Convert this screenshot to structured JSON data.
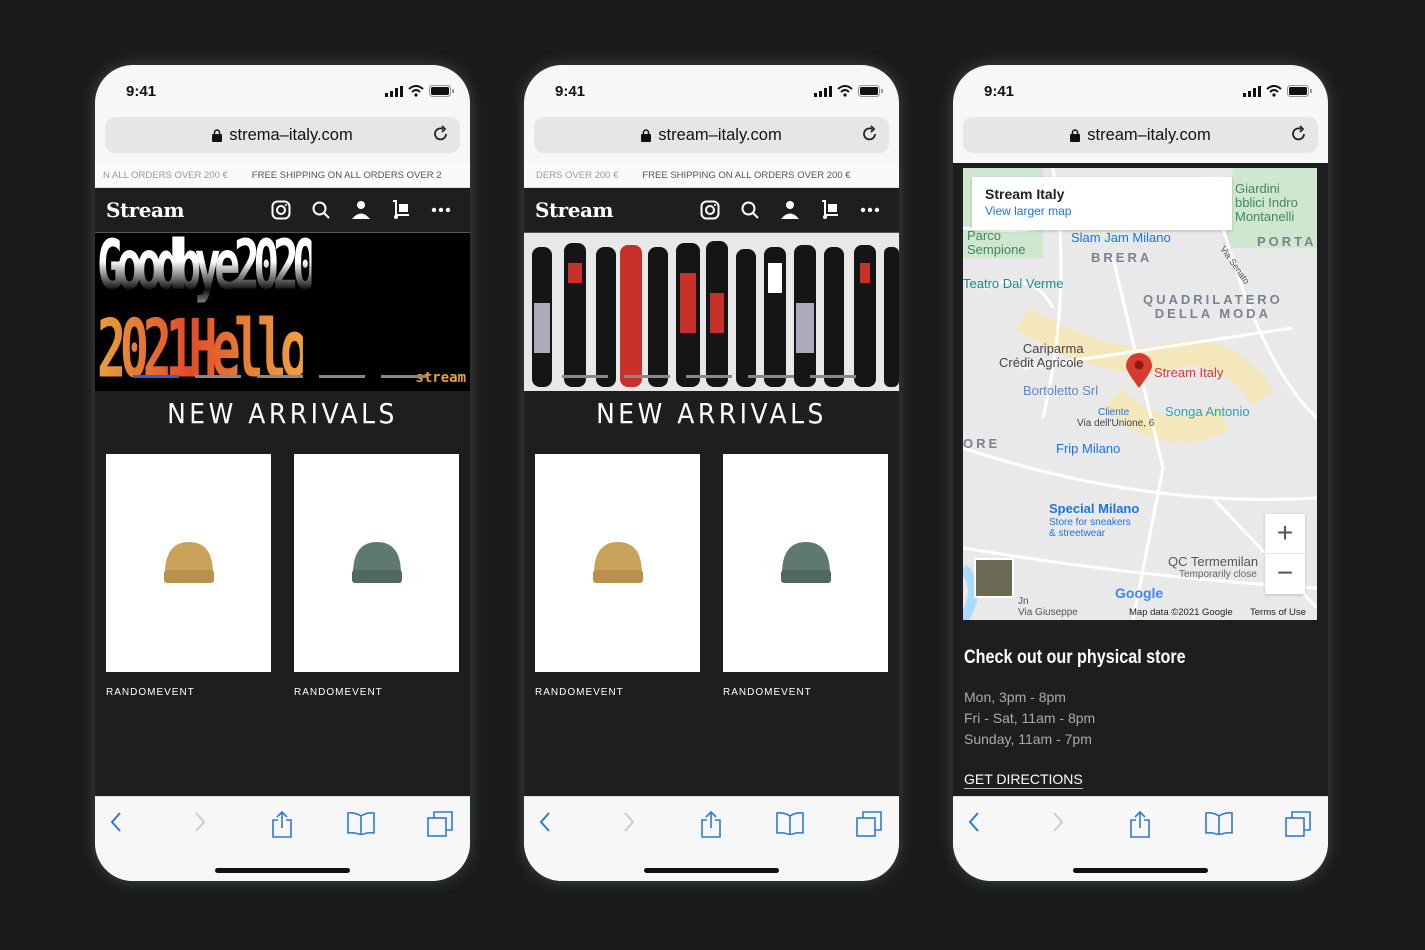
{
  "status": {
    "time": "9:41"
  },
  "phones": [
    {
      "url": "strema–italy.com",
      "promo": [
        "N ALL ORDERS OVER 200 €",
        "FREE SHIPPING ON ALL ORDERS OVER 2"
      ],
      "logo": "Stream",
      "hero": {
        "line1": "Goodbye2020",
        "line2": "2021Hello",
        "tag": "stream"
      },
      "carousel": {
        "slides": 5,
        "active": 1
      },
      "section_title": "NEW ARRIVALS",
      "products": [
        {
          "brand": "RANDOMEVENT",
          "color": "#c9a25a"
        },
        {
          "brand": "RANDOMEVENT",
          "color": "#5e7a6e"
        }
      ]
    },
    {
      "url": "stream–italy.com",
      "promo": [
        "DERS OVER 200 €",
        "FREE SHIPPING ON ALL ORDERS OVER 200 €"
      ],
      "logo": "Stream",
      "carousel": {
        "slides": 5,
        "active": 0
      },
      "section_title": "NEW ARRIVALS",
      "products": [
        {
          "brand": "RANDOMEVENT",
          "color": "#c9a25a"
        },
        {
          "brand": "RANDOMEVENT",
          "color": "#5e7a6e"
        }
      ]
    },
    {
      "url": "stream–italy.com",
      "map": {
        "place": "Stream Italy",
        "link": "View larger map",
        "labels": {
          "giardini": "Giardini\nbblici Indro\nMontanelli",
          "parco": "Parco\nSempione",
          "slamjam": "Slam Jam Milano",
          "brera": "BRERA",
          "porta": "PORTA",
          "senato": "Via Senato",
          "teatro": "Teatro Dal Verme",
          "quad": "QUADRILATERO\nDELLA MODA",
          "cariparma": "Cariparma\nCrédit Agricole",
          "stream": "Stream Italy",
          "bortoletto": "Bortoletto Srl",
          "cliente": "Cliente",
          "unione": "Via dell'Unione, 6",
          "songa": "Songa Antonio",
          "ore": "ORE",
          "frip": "Frip Milano",
          "special": "Special Milano",
          "special_sub": "Store for sneakers\n& streetwear",
          "qc": "QC Termemilan",
          "qc_sub": "Temporarily close",
          "jn": "Jn",
          "giuseppe": "Via Giuseppe",
          "google": "Google",
          "mapdata": "Map data ©2021 Google",
          "terms": "Terms of Use",
          "zoom_in": "+",
          "zoom_out": "−"
        }
      },
      "store_heading": "Check out our physical store",
      "hours": [
        "Mon, 3pm - 8pm",
        "Fri - Sat, 11am - 8pm",
        "Sunday, 11am - 7pm"
      ],
      "directions": "GET DIRECTIONS"
    }
  ],
  "colors": {
    "background": "#1b1b1b",
    "content": "#1e1d1f",
    "accent": "#2f7ad6",
    "pin": "#d93a30"
  }
}
